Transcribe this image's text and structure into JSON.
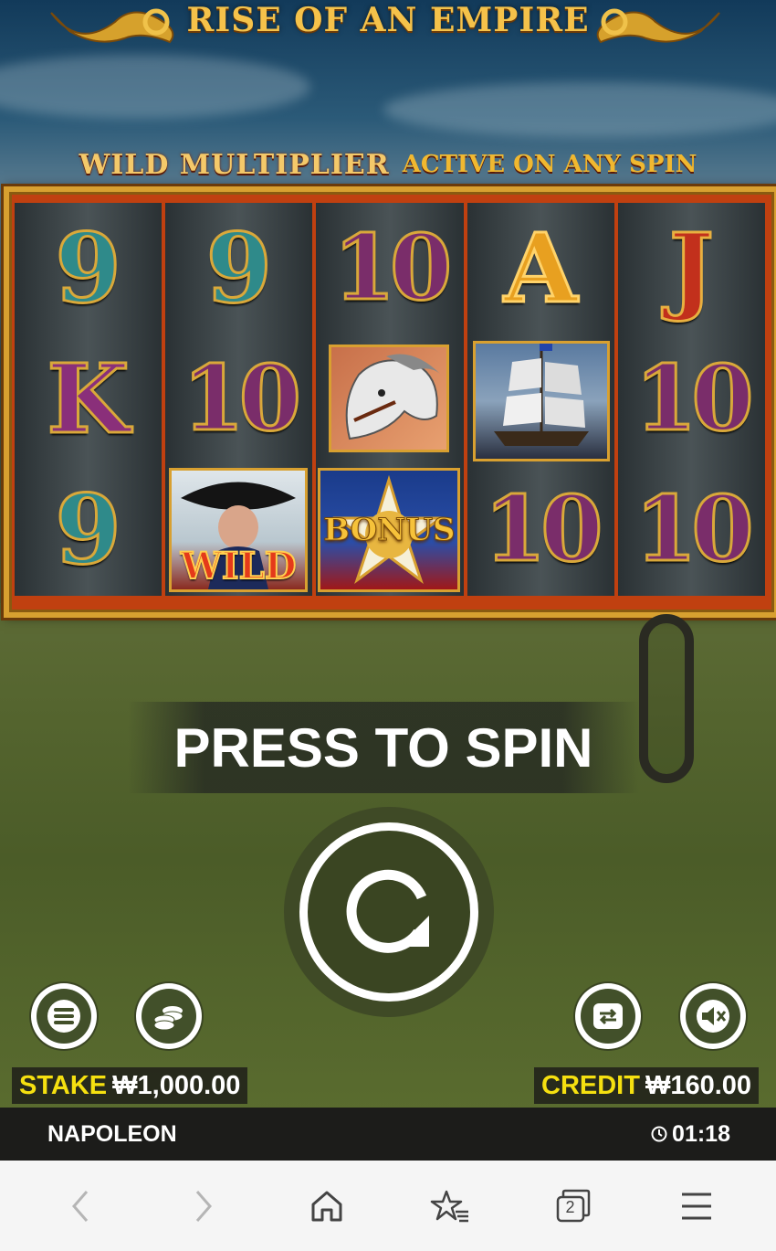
{
  "game": {
    "title": "RISE OF AN EMPIRE",
    "banner_main": "WILD MULTIPLIER",
    "banner_sub": "ACTIVE ON ANY SPIN"
  },
  "reels": [
    [
      "9",
      "K",
      "9"
    ],
    [
      "9",
      "10",
      "WILD"
    ],
    [
      "10",
      "HORSE",
      "BONUS"
    ],
    [
      "A",
      "SHIP",
      "10"
    ],
    [
      "J",
      "10",
      "10"
    ]
  ],
  "symbols": {
    "wild_label": "WILD",
    "bonus_label": "BONUS"
  },
  "spin": {
    "prompt": "PRESS TO SPIN"
  },
  "controls": {
    "menu_icon": "hamburger-icon",
    "coins_icon": "coins-icon",
    "autoplay_icon": "autoplay-repeat-icon",
    "sound_icon": "speaker-muted-icon"
  },
  "stake": {
    "label": "STAKE",
    "value": "₩1,000.00"
  },
  "credit": {
    "label": "CREDIT",
    "value": "₩160.00"
  },
  "footer": {
    "game_name": "NAPOLEON",
    "time": "01:18"
  },
  "browser_nav": {
    "tab_count": "2"
  },
  "colors": {
    "gold": "#d8a030",
    "label_yellow": "#f5e010",
    "field_green": "#55652f"
  }
}
